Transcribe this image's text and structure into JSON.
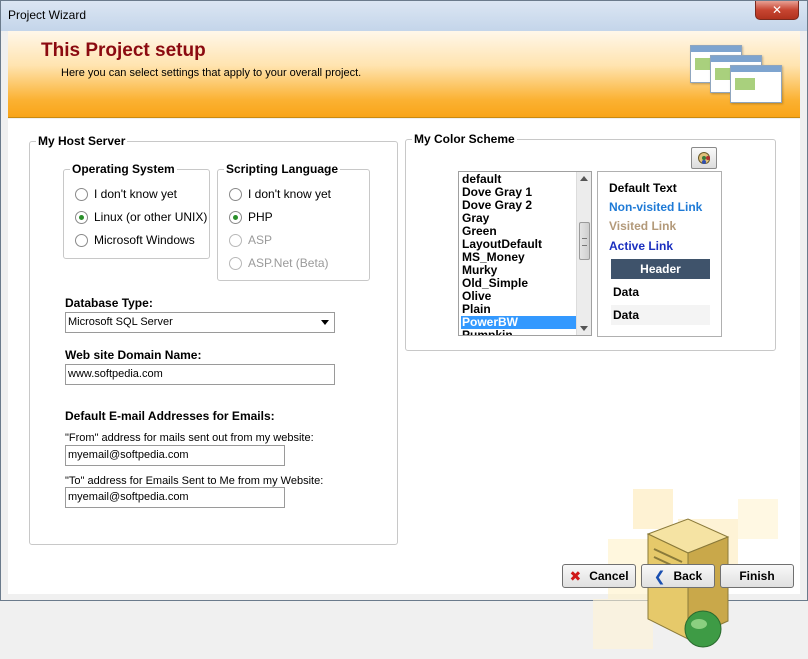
{
  "window": {
    "title": "Project Wizard",
    "close_label": "✕"
  },
  "banner": {
    "title": "This Project setup",
    "subtitle": "Here you can select settings that apply to your overall project."
  },
  "host": {
    "group_label": "My Host Server",
    "os": {
      "label": "Operating System",
      "options": [
        {
          "label": "I don't know yet",
          "checked": false
        },
        {
          "label": "Linux (or other UNIX)",
          "checked": true
        },
        {
          "label": "Microsoft Windows",
          "checked": false
        }
      ]
    },
    "scripting": {
      "label": "Scripting Language",
      "options": [
        {
          "label": "I don't know yet",
          "checked": false
        },
        {
          "label": "PHP",
          "checked": true
        },
        {
          "label": "ASP",
          "checked": false
        },
        {
          "label": "ASP.Net  (Beta)",
          "checked": false
        }
      ]
    },
    "db_label": "Database Type:",
    "db_value": "Microsoft SQL Server",
    "domain_label": "Web site Domain Name:",
    "domain_value": "www.softpedia.com",
    "emails_label": "Default E-mail Addresses for Emails:",
    "from_label": "\"From\" address for mails sent out from my website:",
    "from_value": "myemail@softpedia.com",
    "to_label": "\"To\" address for  Emails Sent to Me from my Website:",
    "to_value": "myemail@softpedia.com"
  },
  "color": {
    "group_label": "My Color Scheme",
    "schemes": [
      "default",
      "Dove Gray 1",
      "Dove Gray 2",
      "Gray",
      "Green",
      "LayoutDefault",
      "MS_Money",
      "Murky",
      "Old_Simple",
      "Olive",
      "Plain",
      "PowerBW",
      "Pumpkin"
    ],
    "selected": "PowerBW",
    "preview": {
      "default_text": "Default Text",
      "nonvisited": "Non-visited Link",
      "visited": "Visited Link",
      "active": "Active Link",
      "header": "Header",
      "data1": "Data",
      "data2": "Data"
    },
    "colors": {
      "nonvisited": "#1e7ad6",
      "visited": "#b39a7a",
      "active": "#1a2fbf",
      "header_bg": "#3f536b"
    }
  },
  "icons": {
    "palette": "palette-icon",
    "server": "server-icon",
    "cancel": "red-x-icon",
    "back": "back-arrow-icon"
  },
  "buttons": {
    "cancel": "Cancel",
    "back": "Back",
    "finish": "Finish"
  }
}
